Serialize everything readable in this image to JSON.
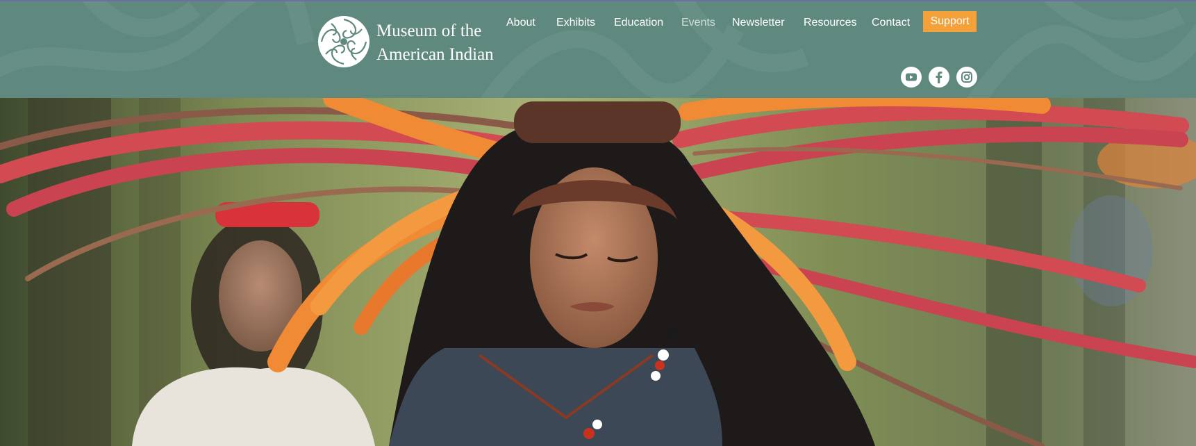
{
  "brand": {
    "logo_icon": "spiral-seal-icon",
    "line1": "Museum of the",
    "line2": "American Indian"
  },
  "nav": {
    "items": [
      {
        "label": "About"
      },
      {
        "label": "Exhibits"
      },
      {
        "label": "Education"
      },
      {
        "label": "Events",
        "active": true
      },
      {
        "label": "Newsletter"
      },
      {
        "label": "Resources"
      },
      {
        "label": "Contact"
      }
    ],
    "support_label": "Support"
  },
  "social": [
    {
      "icon": "youtube-icon"
    },
    {
      "icon": "facebook-icon"
    },
    {
      "icon": "instagram-icon"
    }
  ],
  "hero": {
    "image": "dancer-in-feathered-headdress"
  },
  "colors": {
    "header_bg": "#5f887e",
    "accent": "#f5a13a",
    "text": "#ffffff"
  }
}
